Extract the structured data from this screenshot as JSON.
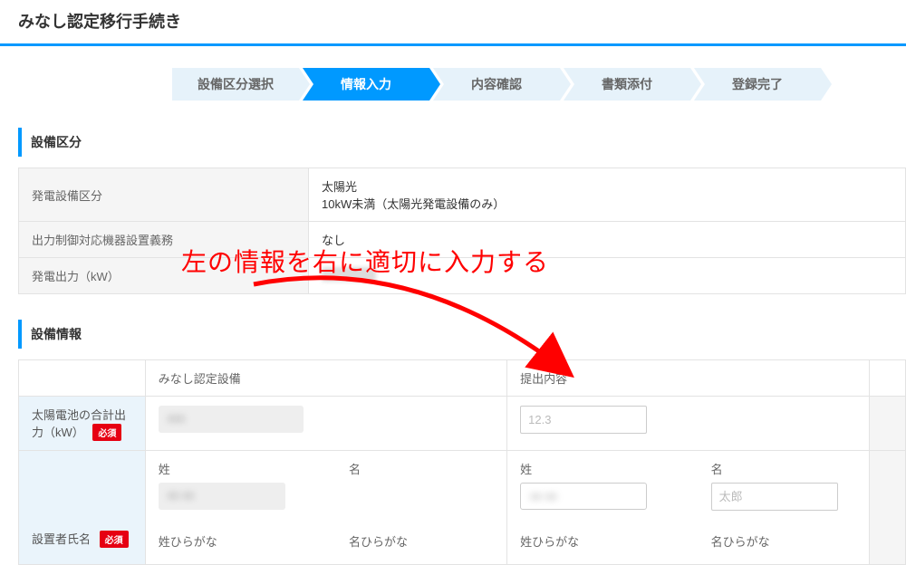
{
  "page_title": "みなし認定移行手続き",
  "steps": [
    "設備区分選択",
    "情報入力",
    "内容確認",
    "書類添付",
    "登録完了"
  ],
  "active_step_index": 1,
  "section1_title": "設備区分",
  "section1_rows": [
    {
      "label": "発電設備区分",
      "value1": "太陽光",
      "value2": "10kW未満（太陽光発電設備のみ）"
    },
    {
      "label": "出力制御対応機器設置義務",
      "value1": "なし",
      "value2": ""
    },
    {
      "label": "発電出力（kW）",
      "value1": "",
      "value2": ""
    }
  ],
  "section2_title": "設備情報",
  "detail_headers": {
    "left": "みなし認定設備",
    "right": "提出内容"
  },
  "detail_rows": {
    "row1_label": "太陽電池の合計出力（kW）",
    "row1_placeholder": "12.3",
    "row2_label": "設置者氏名",
    "sei": "姓",
    "mei": "名",
    "sei_hira": "姓ひらがな",
    "mei_hira": "名ひらがな",
    "mei_placeholder": "太郎"
  },
  "required_badge": "必須",
  "annotation_text": "左の情報を右に適切に入力する"
}
